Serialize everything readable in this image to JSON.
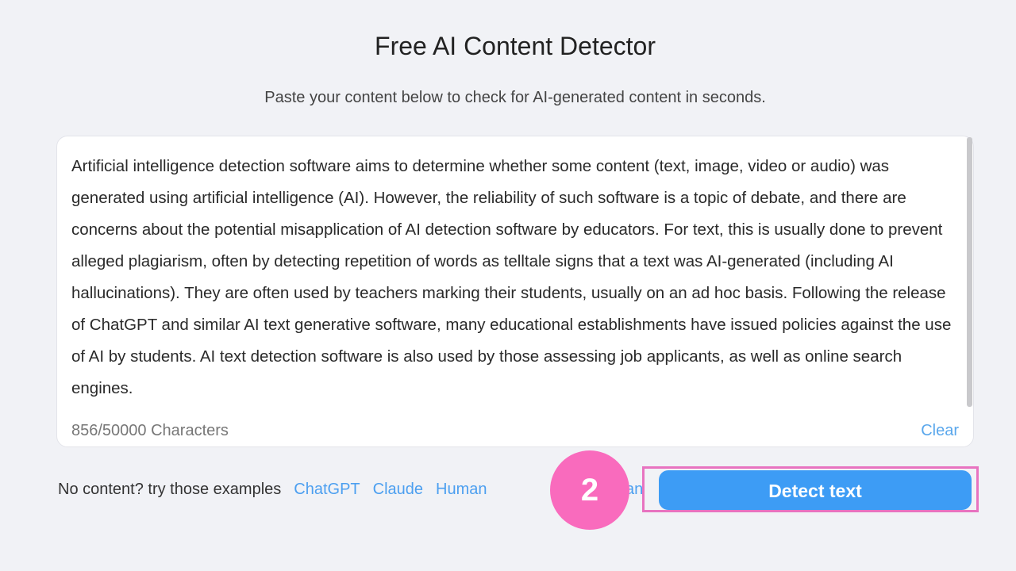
{
  "header": {
    "title": "Free AI Content Detector",
    "subtitle": "Paste your content below to check for AI-generated content in seconds."
  },
  "editor": {
    "text": "Artificial intelligence detection software aims to determine whether some content (text, image, video or audio) was generated using artificial intelligence (AI). However, the reliability of such software is a topic of debate, and there are concerns about the potential misapplication of AI detection software by educators. For text, this is usually done to prevent alleged plagiarism, often by detecting repetition of words as telltale signs that a text was AI-generated (including AI hallucinations). They are often used by teachers marking their students, usually on an ad hoc basis. Following the release of ChatGPT and similar AI text generative software, many educational establishments have issued policies against the use of AI by students. AI text detection software is also used by those assessing job applicants, as well as online search engines.",
    "char_count": "856/50000 Characters",
    "clear_label": "Clear"
  },
  "examples": {
    "prompt": "No content? try those examples",
    "links": [
      "ChatGPT",
      "Claude",
      "Human"
    ],
    "partial_link": "an"
  },
  "detect_button": "Detect text",
  "step_badge": "2",
  "colors": {
    "accent": "#3d9cf5",
    "highlight": "#e873c0",
    "badge": "#f96bbd"
  }
}
